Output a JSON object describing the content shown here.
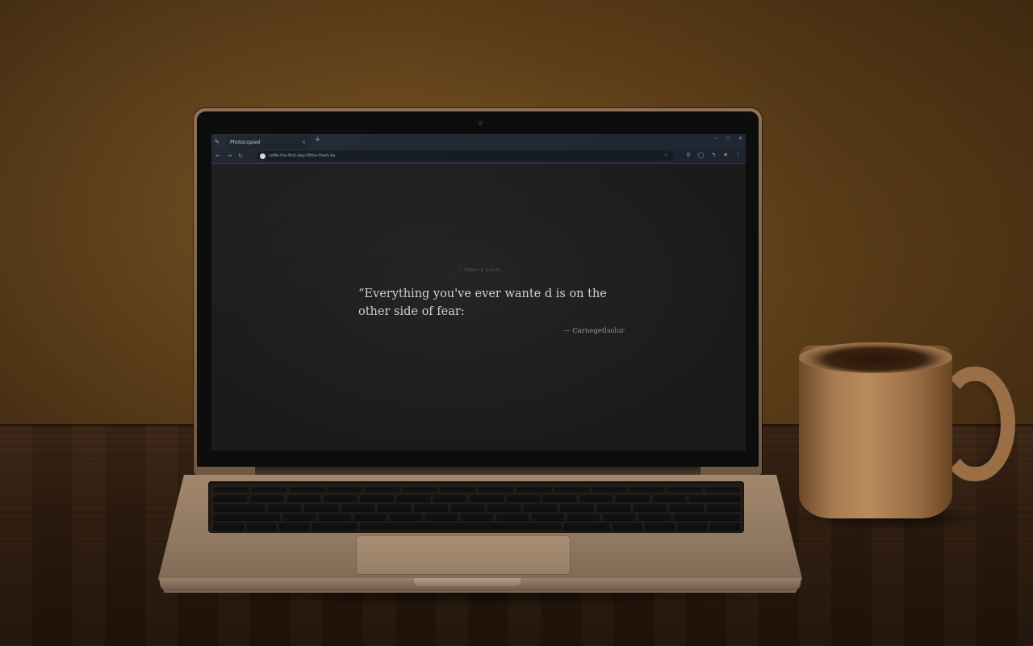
{
  "browser": {
    "tab_title": "Photocopied",
    "tab_close": "×",
    "new_tab": "+",
    "window_controls": [
      "–",
      "▢",
      "✕"
    ],
    "url": "ceffe-the-first-day-fifthe-them-ka",
    "addr_right": "☆",
    "nav": [
      "←",
      "→",
      "↻"
    ],
    "toolbar_icons": [
      "⚲",
      "◯",
      "↰",
      "✶",
      "⋮"
    ]
  },
  "page": {
    "eyebrow": "— TODAY'S QUOTE",
    "quote": "“Everything you've ever wante d is on the other side of fear:",
    "author": "— Carnegetlsolur"
  },
  "colors": {
    "screen_bg": "#1c1c1c",
    "quote_text": "#d6d1c8",
    "wall": "#5a3b17",
    "mug": "#a77b4f"
  }
}
